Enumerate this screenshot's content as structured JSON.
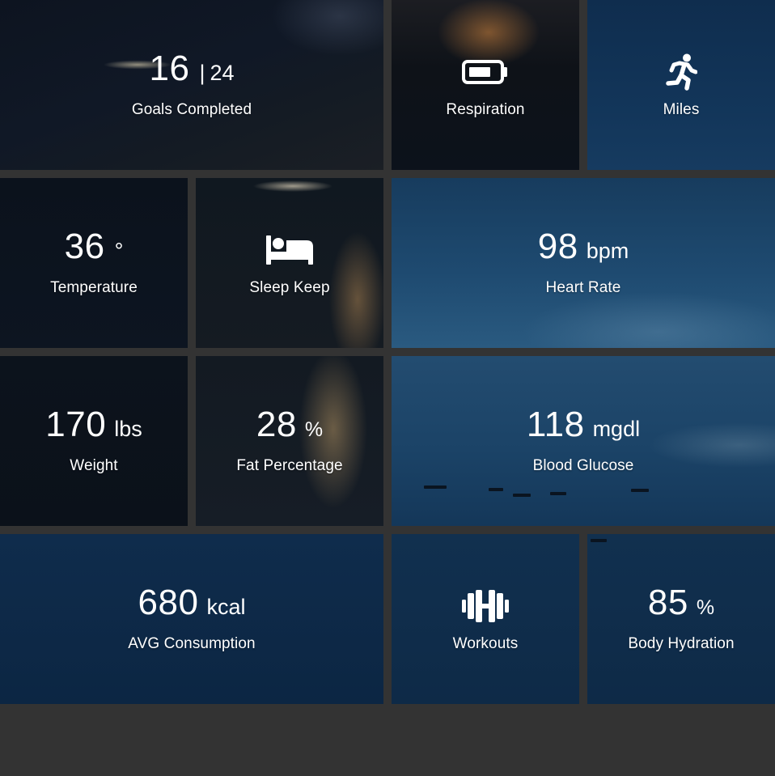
{
  "tiles": {
    "goals": {
      "value": "16",
      "separator": "|",
      "total": "24",
      "label": "Goals Completed"
    },
    "respiration": {
      "icon": "battery-icon",
      "label": "Respiration"
    },
    "miles": {
      "icon": "running-icon",
      "label": "Miles"
    },
    "temperature": {
      "value": "36",
      "unit": "°",
      "label": "Temperature"
    },
    "sleep": {
      "icon": "bed-icon",
      "label": "Sleep Keep"
    },
    "heart_rate": {
      "value": "98",
      "unit": "bpm",
      "label": "Heart Rate"
    },
    "weight": {
      "value": "170",
      "unit": "lbs",
      "label": "Weight"
    },
    "fat": {
      "value": "28",
      "unit": "%",
      "label": "Fat Percentage"
    },
    "glucose": {
      "value": "118",
      "unit": "mgdl",
      "label": "Blood Glucose"
    },
    "consumption": {
      "value": "680",
      "unit": "kcal",
      "label": "AVG Consumption"
    },
    "workouts": {
      "icon": "dumbbell-icon",
      "label": "Workouts"
    },
    "hydration": {
      "value": "85",
      "unit": "%",
      "label": "Body Hydration"
    }
  },
  "colors": {
    "gap": "#333333",
    "text": "#ffffff"
  }
}
